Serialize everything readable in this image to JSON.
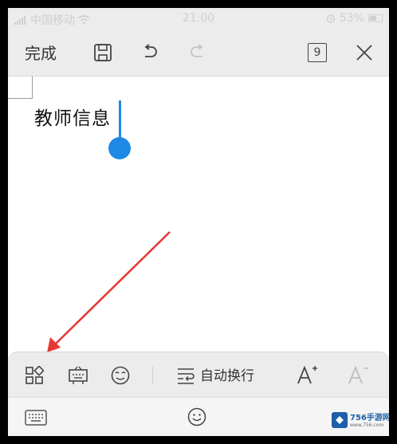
{
  "status_bar": {
    "carrier": "中国移动",
    "time": "21:00",
    "battery": "53%"
  },
  "toolbar": {
    "done_label": "完成",
    "page_count": "9"
  },
  "document": {
    "text": "教师信息"
  },
  "format_bar": {
    "auto_wrap_label": "自动换行"
  },
  "watermark": {
    "name": "756手游网",
    "url": "www.756.com"
  },
  "icons": [
    "grid-apps-icon",
    "keyboard-toggle-icon",
    "mask-icon",
    "wrap-text-icon",
    "font-increase-icon",
    "font-decrease-icon",
    "keyboard-icon",
    "emoji-icon"
  ],
  "colors": {
    "accent": "#1e88e5",
    "arrow": "#e53935"
  }
}
